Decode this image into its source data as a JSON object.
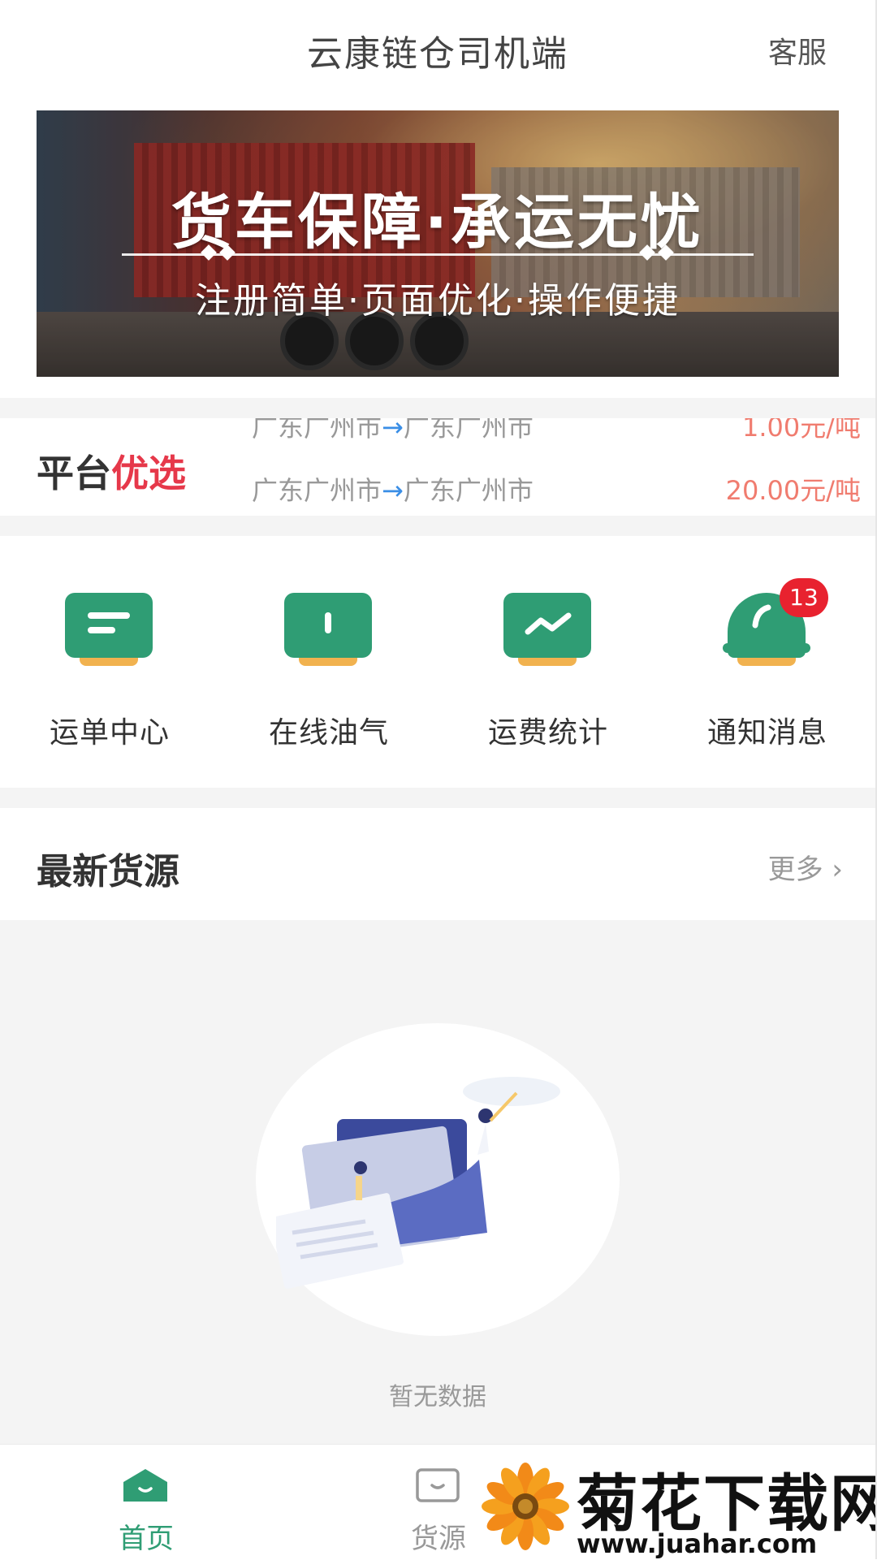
{
  "header": {
    "title": "云康链仓司机端",
    "service_label": "客服"
  },
  "banner": {
    "headline": "货车保障·承运无忧",
    "subline": "注册简单·页面优化·操作便捷"
  },
  "platform_preferred": {
    "label_plain": "平台",
    "label_accent": "优选",
    "accent_color": "#e6384a",
    "items": [
      {
        "route_from": "广东广州市",
        "route_to": "广东广州市",
        "price": "1.00元/吨"
      },
      {
        "route_from": "广东广州市",
        "route_to": "广东广州市",
        "price": "20.00元/吨"
      }
    ]
  },
  "quick_menu": {
    "items": [
      {
        "label": "运单中心",
        "icon": "waybill-icon"
      },
      {
        "label": "在线油气",
        "icon": "fuel-icon"
      },
      {
        "label": "运费统计",
        "icon": "chart-icon"
      },
      {
        "label": "通知消息",
        "icon": "bell-icon",
        "badge": "13"
      }
    ],
    "icon_color": "#2f9d74",
    "icon_base_color": "#f1b24f"
  },
  "newest": {
    "title": "最新货源",
    "more_label": "更多"
  },
  "empty_state": {
    "text": "暂无数据"
  },
  "tabbar": {
    "items": [
      {
        "label": "首页",
        "icon": "home-icon",
        "active": true
      },
      {
        "label": "货源",
        "icon": "cargo-icon",
        "active": false
      }
    ],
    "active_color": "#2f9d74",
    "inactive_color": "#999999"
  },
  "watermark": {
    "text": "菊花下载网",
    "url": "www.juahar.com"
  }
}
